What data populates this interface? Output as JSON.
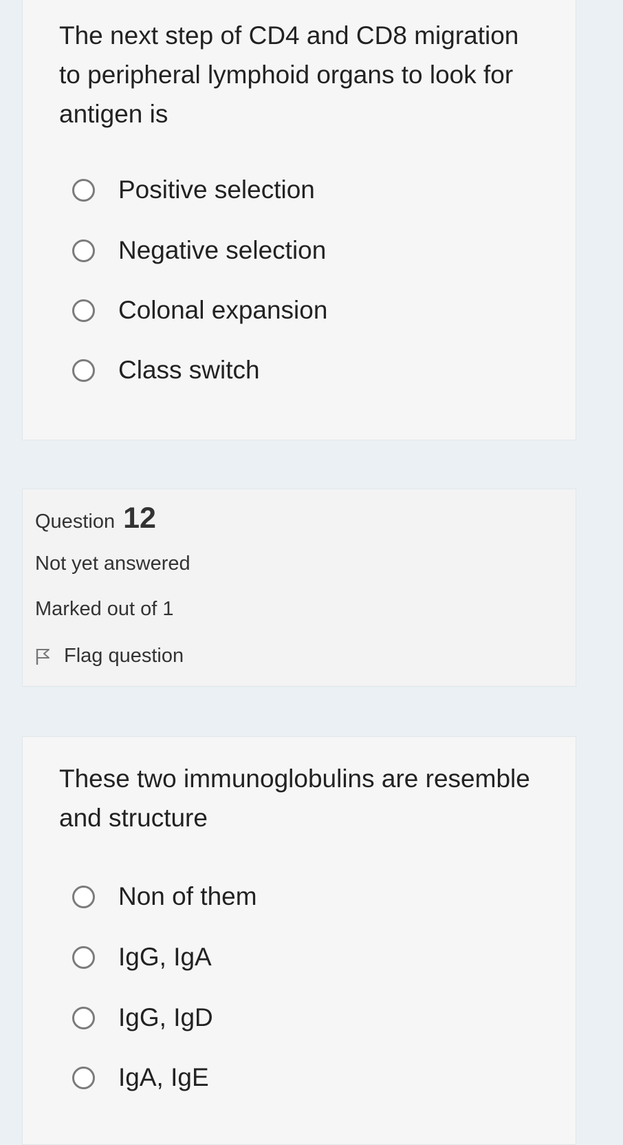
{
  "question11": {
    "text": "The next step of CD4 and CD8 migration to peripheral lymphoid organs to look for antigen is",
    "options": [
      "Positive selection",
      "Negative selection",
      "Colonal expansion",
      "Class switch"
    ]
  },
  "question12_info": {
    "label": "Question",
    "number": "12",
    "state": "Not yet answered",
    "mark": "Marked out of 1",
    "flag_label": "Flag question"
  },
  "question12": {
    "text": "These two immunoglobulins are resemble and structure",
    "options": [
      "Non of them",
      "IgG, IgA",
      "IgG, IgD",
      "IgA, IgE"
    ]
  },
  "icons": {
    "radio": "radio-unselected-icon",
    "flag": "flag-icon"
  }
}
